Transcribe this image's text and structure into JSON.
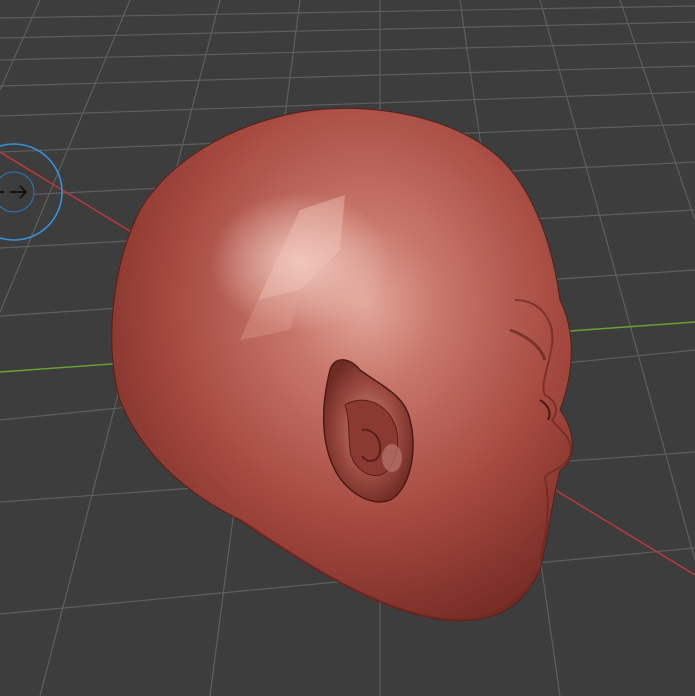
{
  "viewport": {
    "background_color": "#3d3d3d",
    "grid_color": "#5a5a5a",
    "x_axis_color": "#c0393b",
    "y_axis_color": "#6aa333",
    "mesh_base_color": "#a8483d",
    "mesh_highlight_color": "#e8b2a6",
    "gizmo_ring_color": "#3b8fd9"
  },
  "mesh": {
    "icon": "sculpted-head-mesh"
  },
  "gizmo": {
    "icon": "rotate-view-arrow-icon"
  }
}
